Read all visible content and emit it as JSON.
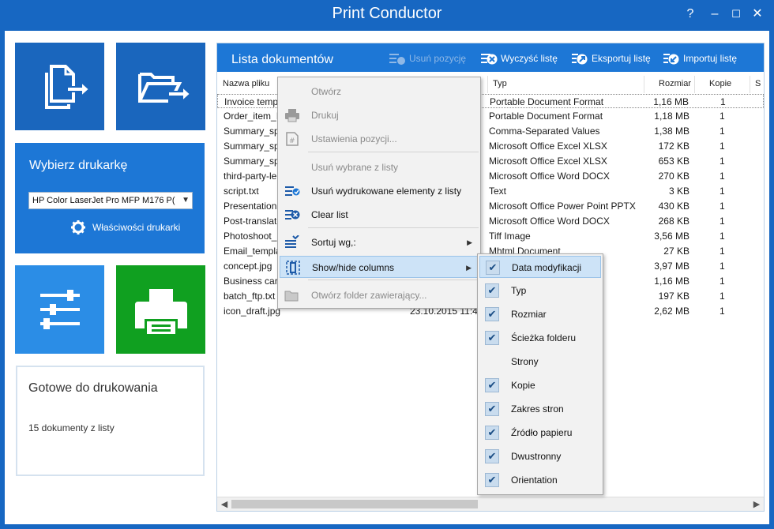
{
  "window": {
    "title": "Print Conductor",
    "help": "?",
    "minimize": "–",
    "maximize": "☐",
    "close": "✕"
  },
  "printer": {
    "title": "Wybierz drukarkę",
    "selected": "HP Color LaserJet Pro MFP M176 P(",
    "properties": "Właściwości drukarki"
  },
  "status": {
    "title": "Gotowe do drukowania",
    "text": "15 dokumenty z listy"
  },
  "list": {
    "title": "Lista dokumentów",
    "buttons": {
      "remove": "Usuń pozycję",
      "clear": "Wyczyść listę",
      "export": "Eksportuj listę",
      "import": "Importuj listę"
    },
    "columns": {
      "name": "Nazwa pliku",
      "type": "Typ",
      "size": "Rozmiar",
      "copies": "Kopie",
      "more": "S"
    },
    "rows": [
      {
        "name": "Invoice temp",
        "type": "Portable Document Format",
        "size": "1,16 MB",
        "copies": "1"
      },
      {
        "name": "Order_item_ID",
        "type": "Portable Document Format",
        "size": "1,18 MB",
        "copies": "1"
      },
      {
        "name": "Summary_spr",
        "type": "Comma-Separated Values",
        "size": "1,38 MB",
        "copies": "1"
      },
      {
        "name": "Summary_spr",
        "type": "Microsoft Office Excel XLSX",
        "size": "172 KB",
        "copies": "1"
      },
      {
        "name": "Summary_spr",
        "type": "Microsoft Office Excel XLSX",
        "size": "653 KB",
        "copies": "1"
      },
      {
        "name": "third-party-le",
        "type": "Microsoft Office Word DOCX",
        "size": "270 KB",
        "copies": "1"
      },
      {
        "name": "script.txt",
        "type": "Text",
        "size": "3 KB",
        "copies": "1"
      },
      {
        "name": "Presentation.",
        "type": "Microsoft Office Power Point PPTX",
        "size": "430 KB",
        "copies": "1"
      },
      {
        "name": "Post-translate",
        "type": "Microsoft Office Word DOCX",
        "size": "268 KB",
        "copies": "1"
      },
      {
        "name": "Photoshoot_",
        "type": "Tiff Image",
        "size": "3,56 MB",
        "copies": "1"
      },
      {
        "name": "Email_templa",
        "type": "Mhtml Document",
        "size": "27 KB",
        "copies": "1"
      },
      {
        "name": "concept.jpg",
        "type": "",
        "size": "3,97 MB",
        "copies": "1"
      },
      {
        "name": "Business card",
        "type": "",
        "size": "1,16 MB",
        "copies": "1"
      },
      {
        "name": "batch_ftp.txt",
        "type": "",
        "size": "197 KB",
        "copies": "1"
      },
      {
        "name": "icon_draft.jpg",
        "date": "23.10.2015 11:48",
        "type": "",
        "size": "2,62 MB",
        "copies": "1"
      }
    ]
  },
  "context_menu": {
    "items": [
      {
        "label": "Otwórz",
        "disabled": true
      },
      {
        "label": "Drukuj",
        "disabled": true
      },
      {
        "label": "Ustawienia pozycji...",
        "disabled": true
      },
      {
        "label": "Usuń wybrane z listy",
        "disabled": true
      },
      {
        "label": "Usuń wydrukowane elementy z listy",
        "disabled": false
      },
      {
        "label": "Clear list",
        "disabled": false
      },
      {
        "label": "Sortuj wg,:",
        "disabled": false
      },
      {
        "label": "Show/hide columns",
        "disabled": false
      },
      {
        "label": "Otwórz folder zawierający...",
        "disabled": true
      }
    ],
    "submenu_arrow": "▶"
  },
  "columns_submenu": {
    "items": [
      {
        "label": "Data modyfikacji",
        "checked": true
      },
      {
        "label": "Typ",
        "checked": true
      },
      {
        "label": "Rozmiar",
        "checked": true
      },
      {
        "label": "Ścieżka folderu",
        "checked": true
      },
      {
        "label": "Strony",
        "checked": false
      },
      {
        "label": "Kopie",
        "checked": true
      },
      {
        "label": "Zakres stron",
        "checked": true
      },
      {
        "label": "Źródło papieru",
        "checked": true
      },
      {
        "label": "Dwustronny",
        "checked": true
      },
      {
        "label": "Orientation",
        "checked": true
      }
    ],
    "check_glyph": "✔"
  },
  "colors": {
    "titlebar": "#1767c2",
    "tile_dark": "#1a66bd",
    "tile_mid": "#1d77d6",
    "tile_light": "#2b8de6",
    "print_green": "#10a020"
  }
}
